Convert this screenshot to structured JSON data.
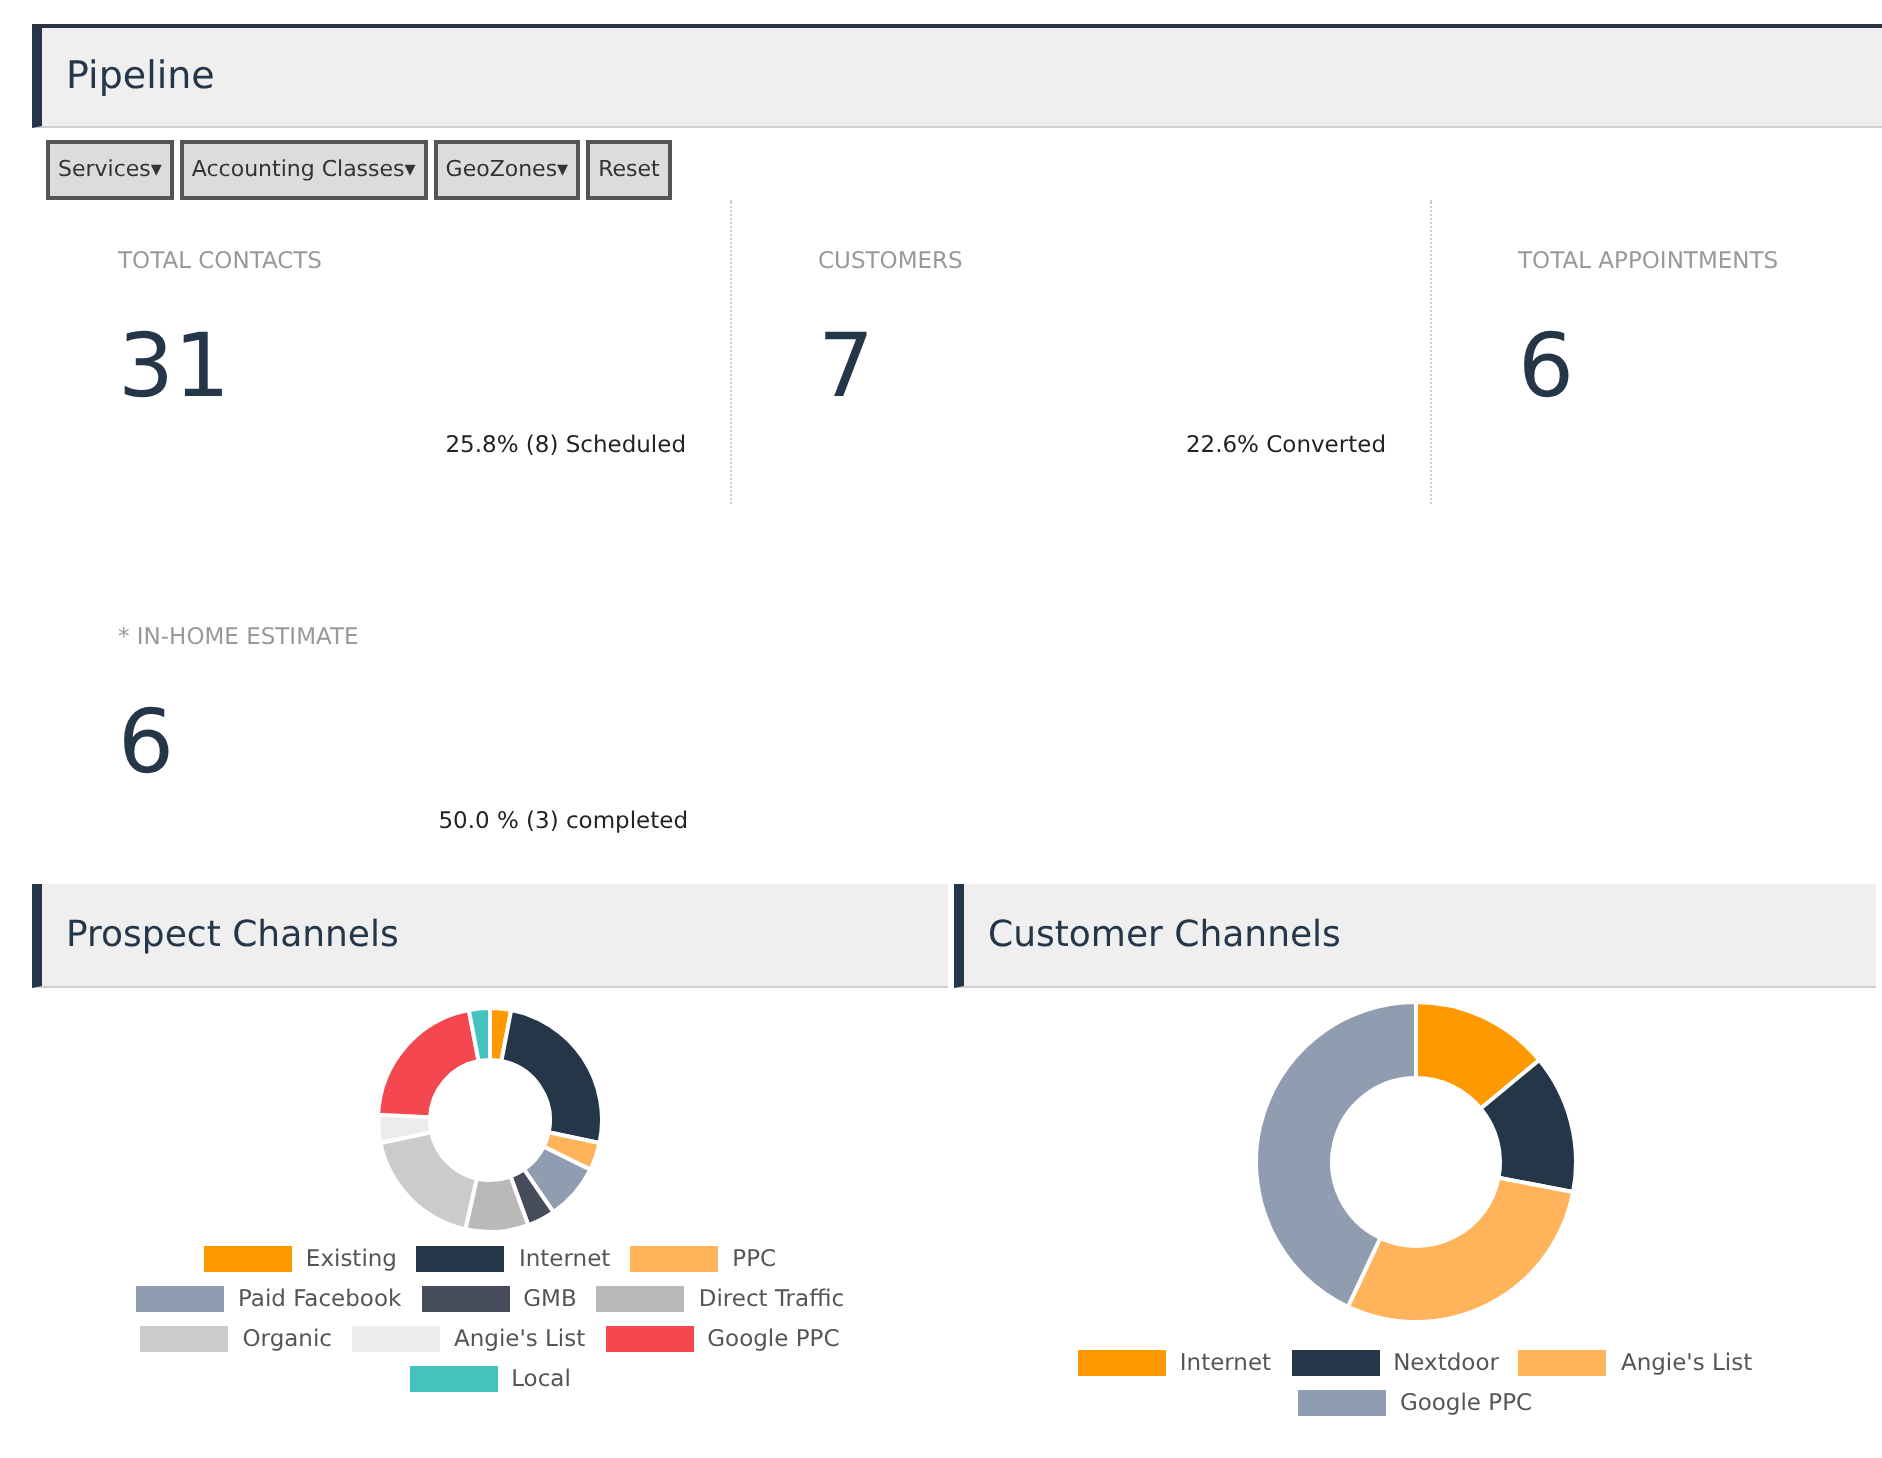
{
  "header": {
    "title": "Pipeline"
  },
  "filters": [
    {
      "label": "Services",
      "kind": "dropdown",
      "caret": "▾"
    },
    {
      "label": "Accounting Classes",
      "kind": "dropdown",
      "caret": "▾"
    },
    {
      "label": "GeoZones",
      "kind": "dropdown",
      "caret": "▾"
    },
    {
      "label": "Reset",
      "kind": "button"
    }
  ],
  "stats": [
    {
      "label": "TOTAL CONTACTS",
      "value": "31",
      "note": "25.8% (8) Scheduled"
    },
    {
      "label": "CUSTOMERS",
      "value": "7",
      "note": "22.6% Converted"
    },
    {
      "label": "TOTAL APPOINTMENTS",
      "value": "6"
    },
    {
      "label": "* IN-HOME ESTIMATE",
      "value": "6",
      "note": "50.0 % (3) completed"
    }
  ],
  "panels": [
    {
      "title": "Prospect Channels",
      "legend": [
        {
          "label": "Existing",
          "color": "#ff9900"
        },
        {
          "label": "Internet",
          "color": "#253649"
        },
        {
          "label": "PPC",
          "color": "#ffb45c"
        },
        {
          "label": "Paid Facebook",
          "color": "#909cb0"
        },
        {
          "label": "GMB",
          "color": "#474c5a"
        },
        {
          "label": "Direct Traffic",
          "color": "#b9b9b9"
        },
        {
          "label": "Organic",
          "color": "#cbcbcb"
        },
        {
          "label": "Angie's List",
          "color": "#ececec"
        },
        {
          "label": "Google PPC",
          "color": "#f5474f"
        },
        {
          "label": "Local",
          "color": "#45c2bd"
        }
      ]
    },
    {
      "title": "Customer Channels",
      "legend": [
        {
          "label": "Internet",
          "color": "#ff9900"
        },
        {
          "label": "Nextdoor",
          "color": "#253649"
        },
        {
          "label": "Angie's List",
          "color": "#ffb45c"
        },
        {
          "label": "Google PPC",
          "color": "#909cb0"
        }
      ]
    }
  ]
}
